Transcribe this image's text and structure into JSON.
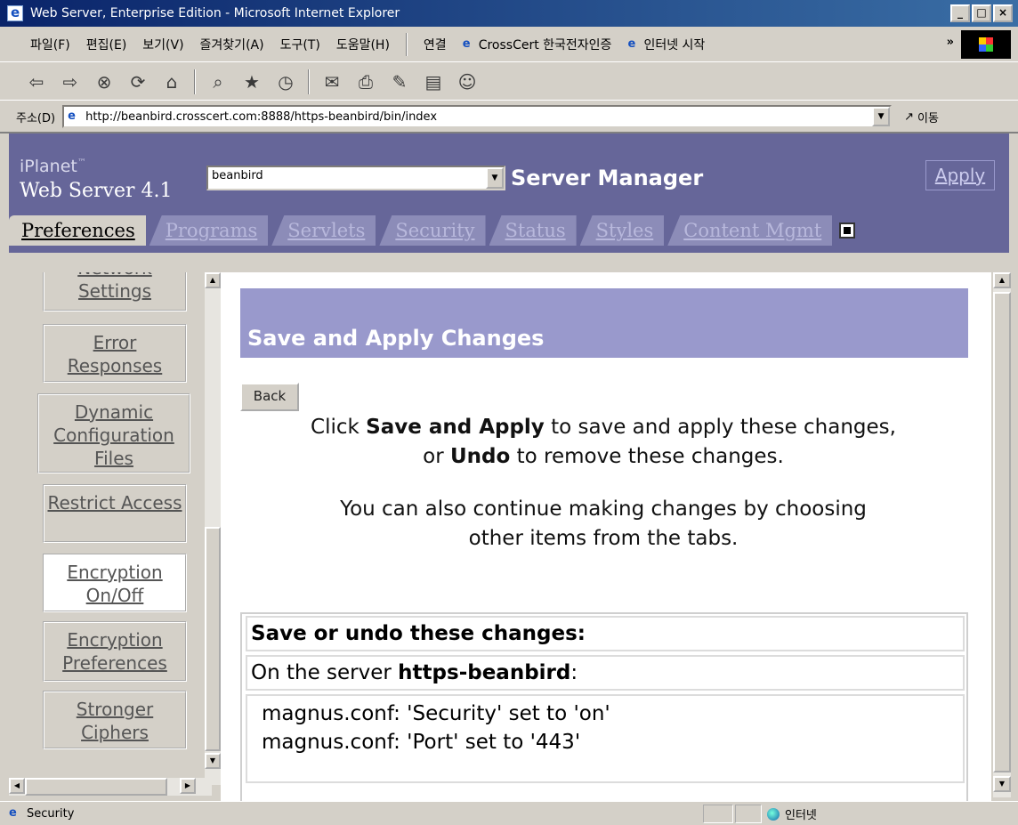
{
  "window": {
    "title": "Web Server, Enterprise Edition - Microsoft Internet Explorer",
    "controls": [
      "_",
      "□",
      "×"
    ]
  },
  "menu": {
    "items": [
      "파일(F)",
      "편집(E)",
      "보기(V)",
      "즐겨찾기(A)",
      "도구(T)",
      "도움말(H)"
    ],
    "links_label": "연결",
    "links": [
      "CrossCert 한국전자인증",
      "인터넷 시작"
    ],
    "chevron": "»"
  },
  "toolbar": {
    "icons": [
      "back-icon",
      "forward-icon",
      "stop-icon",
      "refresh-icon",
      "home-icon",
      "search-icon",
      "favorites-icon",
      "history-icon",
      "mail-icon",
      "print-icon",
      "edit-icon",
      "discuss-icon",
      "messenger-icon"
    ]
  },
  "address": {
    "label": "주소(D)",
    "url": "http://beanbird.crosscert.com:8888/https-beanbird/bin/index",
    "go_label": "이동"
  },
  "header": {
    "brand_line1": "iPlanet",
    "brand_tm": "™",
    "brand_line2": "Web Server 4.1",
    "server_selected": "beanbird",
    "title": "Server Manager",
    "apply_label": "Apply"
  },
  "tabs": [
    {
      "label": "Preferences",
      "active": true
    },
    {
      "label": "Programs",
      "active": false
    },
    {
      "label": "Servlets",
      "active": false
    },
    {
      "label": "Security",
      "active": false
    },
    {
      "label": "Status",
      "active": false
    },
    {
      "label": "Styles",
      "active": false
    },
    {
      "label": "Content Mgmt",
      "active": false
    }
  ],
  "sidebar": {
    "items": [
      {
        "label": "Network Settings"
      },
      {
        "label": "Error Responses"
      },
      {
        "label": "Dynamic Configuration Files"
      },
      {
        "label": "Restrict Access"
      },
      {
        "label": "Encryption On/Off"
      },
      {
        "label": "Encryption Preferences"
      },
      {
        "label": "Stronger Ciphers"
      }
    ]
  },
  "main": {
    "heading": "Save and Apply Changes",
    "back_label": "Back",
    "msg1_pre": "Click ",
    "msg1_b1": "Save and Apply",
    "msg1_mid": " to save and apply these changes,",
    "msg1_or": "or ",
    "msg1_b2": "Undo",
    "msg1_post": " to remove these changes.",
    "msg2": "You can also continue making changes by choosing other items from the tabs.",
    "changes_title": "Save or undo these changes:",
    "server_prefix": "On the server ",
    "server_name": "https-beanbird",
    "server_suffix": ":",
    "change_lines": [
      "magnus.conf: 'Security' set to 'on'",
      "magnus.conf: 'Port' set to '443'"
    ]
  },
  "status": {
    "text": "Security",
    "zone": "인터넷"
  }
}
